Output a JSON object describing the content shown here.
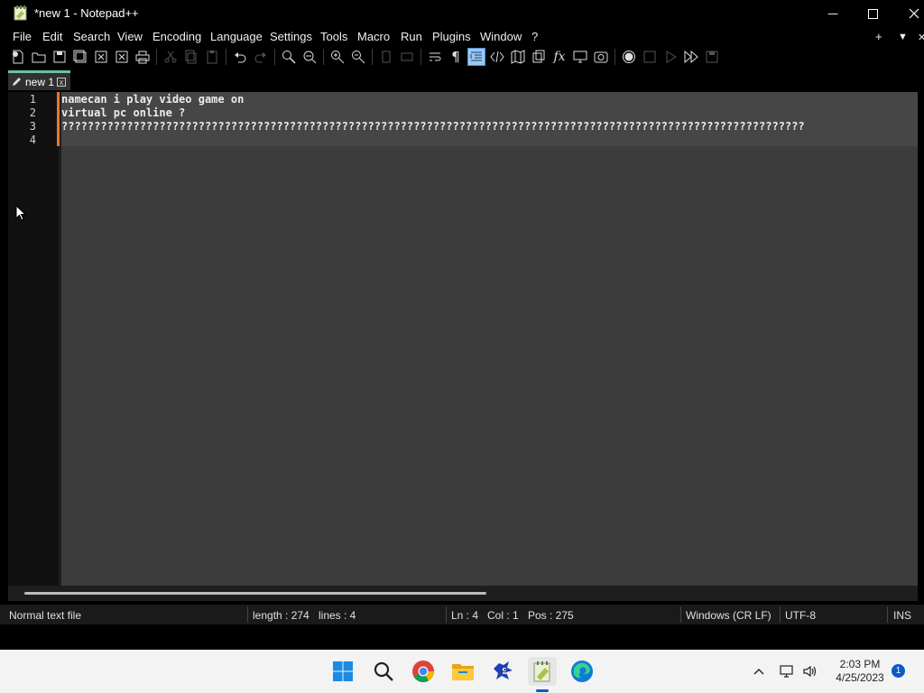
{
  "window": {
    "title": "*new 1 - Notepad++",
    "minimize_glyph": "—",
    "maximize_glyph": "☐",
    "close_glyph": "✕"
  },
  "menu": {
    "items": [
      "File",
      "Edit",
      "Search",
      "View",
      "Encoding",
      "Language",
      "Settings",
      "Tools",
      "Macro",
      "Run",
      "Plugins",
      "Window",
      "?"
    ],
    "right_add": "+",
    "right_dropdown": "▼",
    "right_close": "✕"
  },
  "toolbar": {
    "icons": [
      "new-file-icon",
      "open-file-icon",
      "save-icon",
      "save-all-icon",
      "close-icon",
      "close-all-icon",
      "print-icon",
      "cut-icon",
      "copy-icon",
      "paste-icon",
      "undo-icon",
      "redo-icon",
      "find-icon",
      "replace-icon",
      "zoom-in-icon",
      "zoom-out-icon",
      "sync-vertical-icon",
      "sync-horizontal-icon",
      "word-wrap-icon",
      "show-all-chars-icon",
      "indent-guide-icon",
      "xml-tags-icon",
      "document-map-icon",
      "document-list-icon",
      "function-list-icon",
      "monitor-icon",
      "snapshot-icon",
      "record-macro-icon",
      "stop-macro-icon",
      "play-macro-icon",
      "run-macro-multiple-icon",
      "save-macro-icon"
    ]
  },
  "tab": {
    "label": "new 1",
    "close_glyph": "x"
  },
  "editor": {
    "line_numbers": [
      "1",
      "2",
      "3",
      "4"
    ],
    "lines": [
      "namecan i play video game on",
      "virtual pc online ?",
      "??????????????????????????????????????????????????????????????????????????????????????????????????????????????????",
      ""
    ]
  },
  "status": {
    "file_type": "Normal text file",
    "length": "length : 274",
    "lines": "lines : 4",
    "ln": "Ln : 4",
    "col": "Col : 1",
    "pos": "Pos : 275",
    "eol": "Windows (CR LF)",
    "encoding": "UTF-8",
    "mode": "INS"
  },
  "taskbar": {
    "apps": [
      "windows-start-icon",
      "search-icon",
      "chrome-icon",
      "file-explorer-icon",
      "sonic-icon",
      "notepadpp-icon",
      "edge-icon"
    ],
    "time": "2:03 PM",
    "date": "4/25/2023",
    "notification_count": "1"
  },
  "colors": {
    "accent_tab": "#6bc1a9",
    "change_bar": "#e8752f",
    "editor_bg": "#3c3c3c"
  }
}
